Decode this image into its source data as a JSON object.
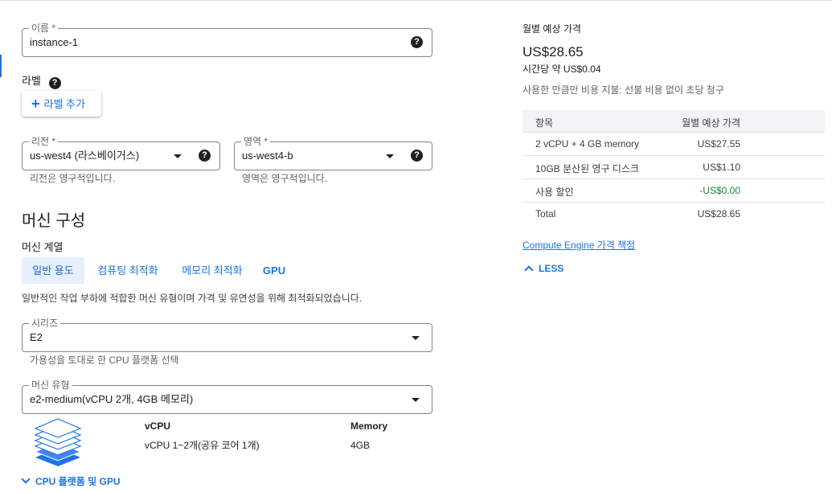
{
  "name_field": {
    "label": "이름 *",
    "value": "instance-1",
    "help": "?"
  },
  "labels": {
    "heading": "라벨",
    "help": "?",
    "add_button": "라벨 추가"
  },
  "region": {
    "label": "리전 *",
    "value": "us-west4 (라스베이거스)",
    "help": "?",
    "hint": "리전은 영구적입니다."
  },
  "zone": {
    "label": "영역 *",
    "value": "us-west4-b",
    "help": "?",
    "hint": "영역은 영구적입니다."
  },
  "machine_config": {
    "title": "머신 구성",
    "family_label": "머신 계열",
    "tabs": [
      {
        "label": "일반 용도",
        "active": true
      },
      {
        "label": "컴퓨팅 최적화",
        "active": false
      },
      {
        "label": "메모리 최적화",
        "active": false
      },
      {
        "label": "GPU",
        "active": false
      }
    ],
    "description": "일반적인 작업 부하에 적합한 머신 유형이며 가격 및 유연성을 위해 최적화되었습니다.",
    "series": {
      "label": "시리즈",
      "value": "E2",
      "hint": "가용성을 토대로 한 CPU 플랫폼 선택"
    },
    "machine_type": {
      "label": "머신 유형",
      "value": "e2-medium(vCPU 2개, 4GB 메모리)"
    },
    "specs": {
      "vcpu_header": "vCPU",
      "memory_header": "Memory",
      "vcpu_value": "vCPU 1~2개(공유 코어 1개)",
      "memory_value": "4GB"
    },
    "expand_link": "CPU 플랫폼 및 GPU"
  },
  "pricing": {
    "title": "월별 예상 가격",
    "monthly_price": "US$28.65",
    "hourly": "시간당 약 US$0.04",
    "note": "사용한 만큼만 비용 지불: 선불 비용 없이 초당 청구",
    "table": {
      "headers": [
        "항목",
        "월별 예상 가격"
      ],
      "rows": [
        {
          "item": "2 vCPU + 4 GB memory",
          "price": "US$27.55"
        },
        {
          "item": "10GB 분산된 영구 디스크",
          "price": "US$1.10"
        },
        {
          "item": "사용 할인",
          "price": "-US$0.00"
        },
        {
          "item": "Total",
          "price": "US$28.65"
        }
      ]
    },
    "link": "Compute Engine 가격 책정",
    "less": "LESS"
  },
  "colors": {
    "accent": "#1a73e8",
    "discount": "#188038",
    "active_tab_bg": "#e8f0fe"
  }
}
